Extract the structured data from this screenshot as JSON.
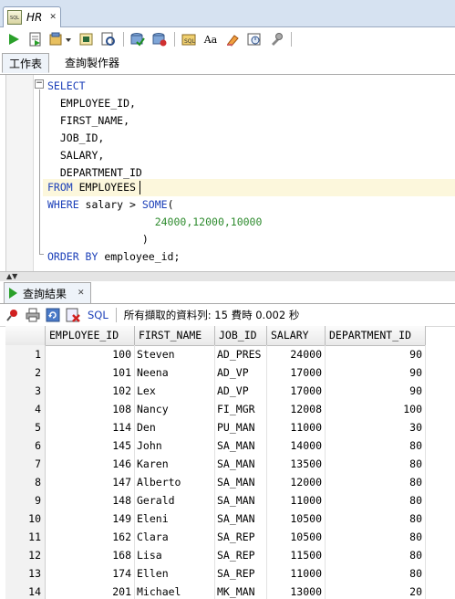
{
  "doc_tab": {
    "title": "HR",
    "icon": "sql-worksheet-icon"
  },
  "toolbar": {
    "items": [
      "run-statement-icon",
      "run-script-icon",
      "commit-dropdown-icon",
      "autotrace-icon",
      "explain-plan-icon",
      "commit-icon",
      "rollback-icon",
      "sql-tuning-icon",
      "to-uppercase-icon",
      "clear-icon",
      "sql-history-icon",
      "tools-icon"
    ]
  },
  "worksheet_tabs": {
    "worksheet": "工作表",
    "query_builder": "查詢製作器"
  },
  "editor": {
    "lines": [
      {
        "kw": "SELECT",
        "rest": ""
      },
      {
        "kw": "",
        "rest": "  EMPLOYEE_ID,"
      },
      {
        "kw": "",
        "rest": "  FIRST_NAME,"
      },
      {
        "kw": "",
        "rest": "  JOB_ID,"
      },
      {
        "kw": "",
        "rest": "  SALARY,"
      },
      {
        "kw": "",
        "rest": "  DEPARTMENT_ID"
      },
      {
        "kw": "FROM",
        "rest": " EMPLOYEES"
      },
      {
        "kw": "WHERE",
        "rest": " salary > ",
        "fn": "SOME",
        "tail": "("
      },
      {
        "kw": "",
        "rest": "                 ",
        "num": "24000,12000,10000"
      },
      {
        "kw": "",
        "rest": "               )"
      },
      {
        "kw": "ORDER BY",
        "rest": " employee_id;"
      }
    ]
  },
  "results": {
    "tab_label": "查詢結果",
    "sql_link": "SQL",
    "status": "所有擷取的資料列: 15 費時 0.002 秒",
    "columns": [
      "EMPLOYEE_ID",
      "FIRST_NAME",
      "JOB_ID",
      "SALARY",
      "DEPARTMENT_ID"
    ],
    "rows": [
      [
        "1",
        "100",
        "Steven",
        "AD_PRES",
        "24000",
        "90"
      ],
      [
        "2",
        "101",
        "Neena",
        "AD_VP",
        "17000",
        "90"
      ],
      [
        "3",
        "102",
        "Lex",
        "AD_VP",
        "17000",
        "90"
      ],
      [
        "4",
        "108",
        "Nancy",
        "FI_MGR",
        "12008",
        "100"
      ],
      [
        "5",
        "114",
        "Den",
        "PU_MAN",
        "11000",
        "30"
      ],
      [
        "6",
        "145",
        "John",
        "SA_MAN",
        "14000",
        "80"
      ],
      [
        "7",
        "146",
        "Karen",
        "SA_MAN",
        "13500",
        "80"
      ],
      [
        "8",
        "147",
        "Alberto",
        "SA_MAN",
        "12000",
        "80"
      ],
      [
        "9",
        "148",
        "Gerald",
        "SA_MAN",
        "11000",
        "80"
      ],
      [
        "10",
        "149",
        "Eleni",
        "SA_MAN",
        "10500",
        "80"
      ],
      [
        "11",
        "162",
        "Clara",
        "SA_REP",
        "10500",
        "80"
      ],
      [
        "12",
        "168",
        "Lisa",
        "SA_REP",
        "11500",
        "80"
      ],
      [
        "13",
        "174",
        "Ellen",
        "SA_REP",
        "11000",
        "80"
      ],
      [
        "14",
        "201",
        "Michael",
        "MK_MAN",
        "13000",
        "20"
      ]
    ]
  }
}
